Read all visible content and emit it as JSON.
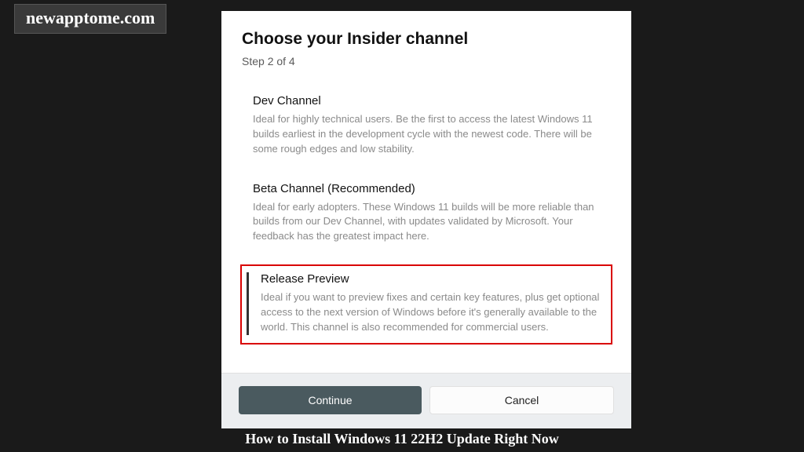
{
  "watermark": "newapptome.com",
  "dialog": {
    "title": "Choose your Insider channel",
    "step": "Step 2 of 4",
    "channels": [
      {
        "title": "Dev Channel",
        "desc": "Ideal for highly technical users. Be the first to access the latest Windows 11 builds earliest in the development cycle with the newest code. There will be some rough edges and low stability.",
        "highlighted": false
      },
      {
        "title": "Beta Channel (Recommended)",
        "desc": "Ideal for early adopters. These Windows 11 builds will be more reliable than builds from our Dev Channel, with updates validated by Microsoft. Your feedback has the greatest impact here.",
        "highlighted": false
      },
      {
        "title": "Release Preview",
        "desc": "Ideal if you want to preview fixes and certain key features, plus get optional access to the next version of Windows before it's generally available to the world. This channel is also recommended for commercial users.",
        "highlighted": true
      }
    ],
    "continue_label": "Continue",
    "cancel_label": "Cancel"
  },
  "caption": "How to Install Windows 11 22H2 Update Right Now"
}
